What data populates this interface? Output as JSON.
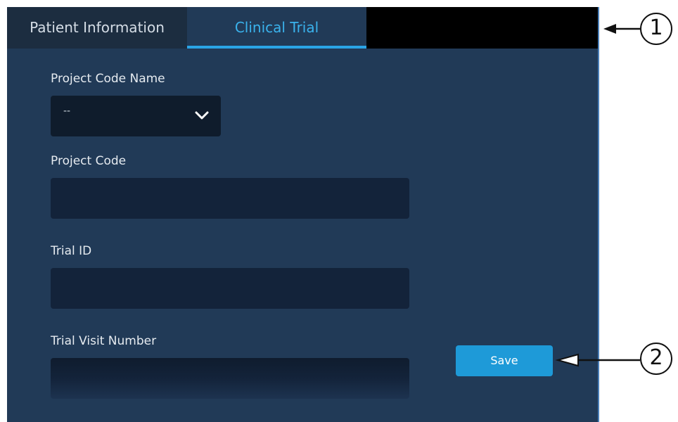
{
  "tabs": [
    {
      "label": "Patient Information",
      "active": false
    },
    {
      "label": "Clinical Trial",
      "active": true
    }
  ],
  "form": {
    "project_code_name": {
      "label": "Project Code  Name",
      "selected_value": "--"
    },
    "project_code": {
      "label": "Project Code",
      "value": ""
    },
    "trial_id": {
      "label": "Trial ID",
      "value": ""
    },
    "trial_visit_number": {
      "label": "Trial Visit Number",
      "value": ""
    }
  },
  "save_button": {
    "label": "Save"
  },
  "callouts": [
    {
      "number": "1"
    },
    {
      "number": "2"
    }
  ],
  "colors": {
    "panel_background": "#213a57",
    "field_background": "#13233a",
    "active_tab_accent": "#2aa4e6",
    "save_button": "#1e9ad8"
  },
  "icons": {
    "select_toggle": "chevron-down-icon",
    "callout_pointer": "arrow-left-icon"
  }
}
